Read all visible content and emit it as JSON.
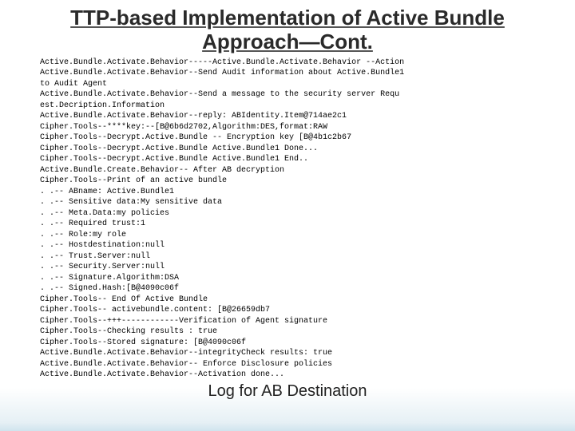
{
  "title_line1": "TTP-based Implementation of Active Bundle",
  "title_line2": "Approach—Cont.",
  "caption": "Log for AB Destination",
  "log_lines": [
    "Active.Bundle.Activate.Behavior-----Active.Bundle.Activate.Behavior --Action",
    "Active.Bundle.Activate.Behavior--Send Audit information about Active.Bundle1",
    " to Audit Agent",
    "Active.Bundle.Activate.Behavior--Send a message to the security server Requ",
    "est.Decription.Information",
    "Active.Bundle.Activate.Behavior--reply: ABIdentity.Item@714ae2c1",
    "Cipher.Tools--****key:--[B@6b6d2702,Algorithm:DES,format:RAW",
    "Cipher.Tools--Decrypt.Active.Bundle -- Encryption key [B@4b1c2b67",
    "Cipher.Tools--Decrypt.Active.Bundle Active.Bundle1 Done...",
    "Cipher.Tools--Decrypt.Active.Bundle Active.Bundle1 End..",
    "Active.Bundle.Create.Behavior-- After AB decryption",
    "Cipher.Tools--Print of an active bundle",
    ". .-- ABname: Active.Bundle1",
    ". .-- Sensitive data:My sensitive data",
    ". .-- Meta.Data:my policies",
    ". .-- Required trust:1",
    ". .-- Role:my role",
    ". .-- Hostdestination:null",
    ". .-- Trust.Server:null",
    ". .-- Security.Server:null",
    ". .-- Signature.Algorithm:DSA",
    ". .-- Signed.Hash:[B@4090c06f",
    "Cipher.Tools-- End Of Active Bundle",
    "Cipher.Tools-- activebundle.content: [B@26659db7",
    "Cipher.Tools--+++------------Verification of Agent signature",
    "Cipher.Tools--Checking results : true",
    "Cipher.Tools--Stored signature: [B@4090c06f",
    "Active.Bundle.Activate.Behavior--integrityCheck results: true",
    "Active.Bundle.Activate.Behavior-- Enforce Disclosure policies",
    "Active.Bundle.Activate.Behavior--Activation done..."
  ]
}
